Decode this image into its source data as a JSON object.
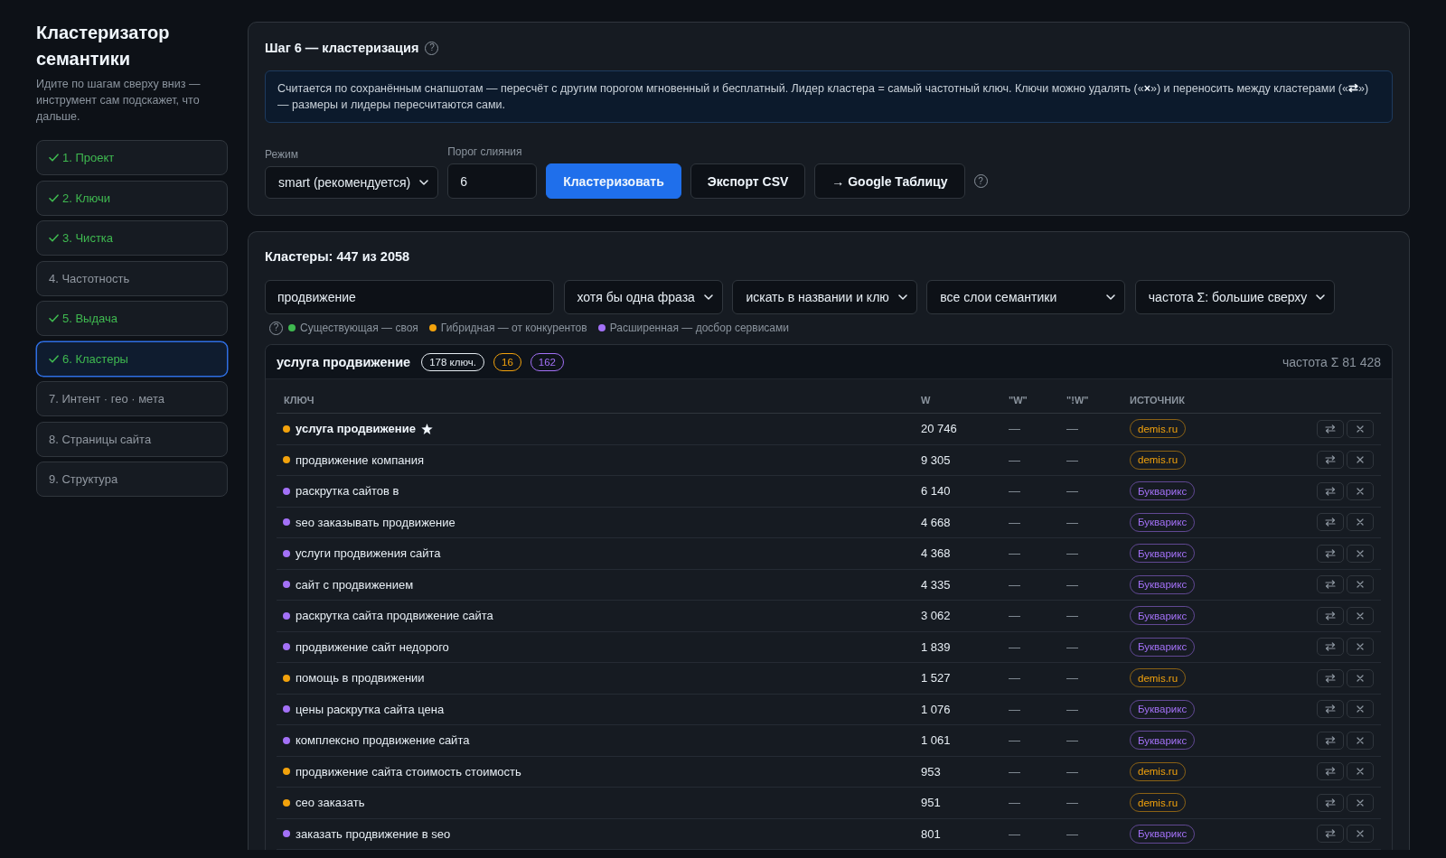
{
  "sidebar": {
    "title": "Кластеризатор семантики",
    "subtitle": "Идите по шагам сверху вниз — инструмент сам подскажет, что дальше.",
    "steps": [
      {
        "label": "1. Проект",
        "done": true,
        "selected": false
      },
      {
        "label": "2. Ключи",
        "done": true,
        "selected": false
      },
      {
        "label": "3. Чистка",
        "done": true,
        "selected": false
      },
      {
        "label": "4. Частотность",
        "done": false,
        "selected": false
      },
      {
        "label": "5. Выдача",
        "done": true,
        "selected": false
      },
      {
        "label": "6. Кластеры",
        "done": true,
        "selected": true
      },
      {
        "label": "7. Интент · гео · мета",
        "done": false,
        "selected": false
      },
      {
        "label": "8. Страницы сайта",
        "done": false,
        "selected": false
      },
      {
        "label": "9. Структура",
        "done": false,
        "selected": false
      }
    ]
  },
  "step_panel": {
    "title": "Шаг 6 — кластеризация",
    "help": "?",
    "info": "Считается по сохранённым снапшотам — пересчёт с другим порогом мгновенный и бесплатный. Лидер кластера = самый частотный ключ. Ключи можно удалять («**×**») и переносить между кластерами («**⇄**») — размеры и лидеры пересчитаются сами.",
    "controls": {
      "mode": {
        "label": "Режим",
        "value": "smart (рекомендуется)"
      },
      "threshold": {
        "label": "Порог слияния",
        "value": "6"
      },
      "buttons": [
        {
          "label": "Кластеризовать",
          "kind": "primary"
        },
        {
          "label": "Экспорт CSV",
          "kind": "secondary"
        },
        {
          "label": "→ Google Таблицу",
          "kind": "secondary"
        }
      ],
      "help": "?"
    }
  },
  "clusters_panel": {
    "title": "Кластеры: 447 из 2058",
    "filters": {
      "search": {
        "value": "продвижение"
      },
      "selects": [
        "хотя бы одна фраза",
        "искать в названии и клю",
        "все слои семантики",
        "частота Σ: большие сверху"
      ]
    },
    "legend": {
      "help": "?",
      "items": [
        {
          "label": "Существующая — своя",
          "color": "#3fb950"
        },
        {
          "label": "Гибридная — от конкурентов",
          "color": "#f2a20c"
        },
        {
          "label": "Расширенная — досбор сервисами",
          "color": "#a371f7"
        }
      ]
    },
    "cluster": {
      "name": "услуга продвижение",
      "badges": [
        {
          "label": "178 ключ.",
          "color": "#e6edf3"
        },
        {
          "label": "16",
          "color": "#f2a20c"
        },
        {
          "label": "162",
          "color": "#a371f7"
        }
      ],
      "frequency": "частота Σ 81 428",
      "columns": [
        "КЛЮЧ",
        "W",
        "\"W\"",
        "\"!W\"",
        "ИСТОЧНИК"
      ],
      "rows": [
        {
          "key": "услуга продвижение",
          "leader": true,
          "color": "#f2a20c",
          "w": "20 746",
          "w_quoted": "—",
          "w_exact": "—",
          "source": "demis.ru"
        },
        {
          "key": "продвижение компания",
          "leader": false,
          "color": "#f2a20c",
          "w": "9 305",
          "w_quoted": "—",
          "w_exact": "—",
          "source": "demis.ru"
        },
        {
          "key": "раскрутка сайтов в",
          "leader": false,
          "color": "#a371f7",
          "w": "6 140",
          "w_quoted": "—",
          "w_exact": "—",
          "source": "Букварикс"
        },
        {
          "key": "seo заказывать продвижение",
          "leader": false,
          "color": "#a371f7",
          "w": "4 668",
          "w_quoted": "—",
          "w_exact": "—",
          "source": "Букварикс"
        },
        {
          "key": "услуги продвижения сайта",
          "leader": false,
          "color": "#a371f7",
          "w": "4 368",
          "w_quoted": "—",
          "w_exact": "—",
          "source": "Букварикс"
        },
        {
          "key": "сайт с продвижением",
          "leader": false,
          "color": "#a371f7",
          "w": "4 335",
          "w_quoted": "—",
          "w_exact": "—",
          "source": "Букварикс"
        },
        {
          "key": "раскрутка сайта продвижение сайта",
          "leader": false,
          "color": "#a371f7",
          "w": "3 062",
          "w_quoted": "—",
          "w_exact": "—",
          "source": "Букварикс"
        },
        {
          "key": "продвижение сайт недорого",
          "leader": false,
          "color": "#a371f7",
          "w": "1 839",
          "w_quoted": "—",
          "w_exact": "—",
          "source": "Букварикс"
        },
        {
          "key": "помощь в продвижении",
          "leader": false,
          "color": "#f2a20c",
          "w": "1 527",
          "w_quoted": "—",
          "w_exact": "—",
          "source": "demis.ru"
        },
        {
          "key": "цены раскрутка сайта цена",
          "leader": false,
          "color": "#a371f7",
          "w": "1 076",
          "w_quoted": "—",
          "w_exact": "—",
          "source": "Букварикс"
        },
        {
          "key": "комплексно продвижение сайта",
          "leader": false,
          "color": "#a371f7",
          "w": "1 061",
          "w_quoted": "—",
          "w_exact": "—",
          "source": "Букварикс"
        },
        {
          "key": "продвижение сайта стоимость стоимость",
          "leader": false,
          "color": "#f2a20c",
          "w": "953",
          "w_quoted": "—",
          "w_exact": "—",
          "source": "demis.ru"
        },
        {
          "key": "сео заказать",
          "leader": false,
          "color": "#f2a20c",
          "w": "951",
          "w_quoted": "—",
          "w_exact": "—",
          "source": "demis.ru"
        },
        {
          "key": "заказать продвижение в seo",
          "leader": false,
          "color": "#a371f7",
          "w": "801",
          "w_quoted": "—",
          "w_exact": "—",
          "source": "Букварикс"
        }
      ]
    }
  }
}
